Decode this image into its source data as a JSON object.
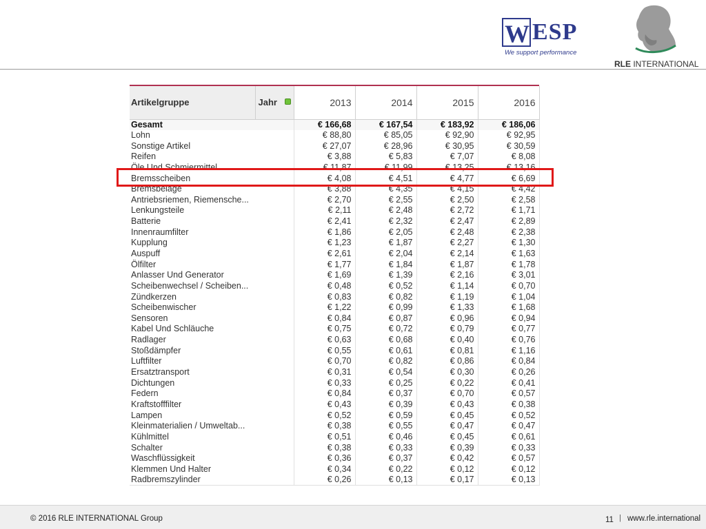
{
  "header": {
    "wesp_logo": {
      "first_letter": "W",
      "rest": "ESP",
      "tagline": "We support performance"
    },
    "rle_logo": {
      "name_bold": "RLE",
      "name_rest": " INTERNATIONAL"
    }
  },
  "table": {
    "headers": {
      "group": "Artikelgruppe",
      "jahr": "Jahr",
      "years": [
        "2013",
        "2014",
        "2015",
        "2016"
      ]
    },
    "total": {
      "label": "Gesamt",
      "values": [
        "€ 166,68",
        "€ 167,54",
        "€ 183,92",
        "€ 186,06"
      ]
    },
    "rows": [
      {
        "label": "Lohn",
        "values": [
          "€ 88,80",
          "€ 85,05",
          "€ 92,90",
          "€ 92,95"
        ]
      },
      {
        "label": "Sonstige Artikel",
        "values": [
          "€ 27,07",
          "€ 28,96",
          "€ 30,95",
          "€ 30,59"
        ]
      },
      {
        "label": "Reifen",
        "values": [
          "€ 3,88",
          "€ 5,83",
          "€ 7,07",
          "€ 8,08"
        ]
      },
      {
        "label": "Öle Und Schmiermittel",
        "values": [
          "€ 11,87",
          "€ 11,99",
          "€ 13,25",
          "€ 13,16"
        ]
      },
      {
        "label": "Bremsscheiben",
        "values": [
          "€ 4,08",
          "€ 4,51",
          "€ 4,77",
          "€ 6,69"
        ]
      },
      {
        "label": "Bremsbeläge",
        "values": [
          "€ 3,88",
          "€ 4,35",
          "€ 4,15",
          "€ 4,42"
        ]
      },
      {
        "label": "Antriebsriemen, Riemensche...",
        "values": [
          "€ 2,70",
          "€ 2,55",
          "€ 2,50",
          "€ 2,58"
        ]
      },
      {
        "label": "Lenkungsteile",
        "values": [
          "€ 2,11",
          "€ 2,48",
          "€ 2,72",
          "€ 1,71"
        ]
      },
      {
        "label": "Batterie",
        "values": [
          "€ 2,41",
          "€ 2,32",
          "€ 2,47",
          "€ 2,89"
        ]
      },
      {
        "label": "Innenraumfilter",
        "values": [
          "€ 1,86",
          "€ 2,05",
          "€ 2,48",
          "€ 2,38"
        ]
      },
      {
        "label": "Kupplung",
        "values": [
          "€ 1,23",
          "€ 1,87",
          "€ 2,27",
          "€ 1,30"
        ]
      },
      {
        "label": "Auspuff",
        "values": [
          "€ 2,61",
          "€ 2,04",
          "€ 2,14",
          "€ 1,63"
        ]
      },
      {
        "label": "Ölfilter",
        "values": [
          "€ 1,77",
          "€ 1,84",
          "€ 1,87",
          "€ 1,78"
        ]
      },
      {
        "label": "Anlasser Und Generator",
        "values": [
          "€ 1,69",
          "€ 1,39",
          "€ 2,16",
          "€ 3,01"
        ]
      },
      {
        "label": "Scheibenwechsel / Scheiben...",
        "values": [
          "€ 0,48",
          "€ 0,52",
          "€ 1,14",
          "€ 0,70"
        ]
      },
      {
        "label": "Zündkerzen",
        "values": [
          "€ 0,83",
          "€ 0,82",
          "€ 1,19",
          "€ 1,04"
        ]
      },
      {
        "label": "Scheibenwischer",
        "values": [
          "€ 1,22",
          "€ 0,99",
          "€ 1,33",
          "€ 1,68"
        ]
      },
      {
        "label": "Sensoren",
        "values": [
          "€ 0,84",
          "€ 0,87",
          "€ 0,96",
          "€ 0,94"
        ]
      },
      {
        "label": "Kabel Und Schläuche",
        "values": [
          "€ 0,75",
          "€ 0,72",
          "€ 0,79",
          "€ 0,77"
        ]
      },
      {
        "label": "Radlager",
        "values": [
          "€ 0,63",
          "€ 0,68",
          "€ 0,40",
          "€ 0,76"
        ]
      },
      {
        "label": "Stoßdämpfer",
        "values": [
          "€ 0,55",
          "€ 0,61",
          "€ 0,81",
          "€ 1,16"
        ]
      },
      {
        "label": "Luftfilter",
        "values": [
          "€ 0,70",
          "€ 0,82",
          "€ 0,86",
          "€ 0,84"
        ]
      },
      {
        "label": "Ersatztransport",
        "values": [
          "€ 0,31",
          "€ 0,54",
          "€ 0,30",
          "€ 0,26"
        ]
      },
      {
        "label": "Dichtungen",
        "values": [
          "€ 0,33",
          "€ 0,25",
          "€ 0,22",
          "€ 0,41"
        ]
      },
      {
        "label": "Federn",
        "values": [
          "€ 0,84",
          "€ 0,37",
          "€ 0,70",
          "€ 0,57"
        ]
      },
      {
        "label": "Kraftstofffilter",
        "values": [
          "€ 0,43",
          "€ 0,39",
          "€ 0,43",
          "€ 0,38"
        ]
      },
      {
        "label": "Lampen",
        "values": [
          "€ 0,52",
          "€ 0,59",
          "€ 0,45",
          "€ 0,52"
        ]
      },
      {
        "label": "Kleinmaterialien / Umweltab...",
        "values": [
          "€ 0,38",
          "€ 0,55",
          "€ 0,47",
          "€ 0,47"
        ]
      },
      {
        "label": "Kühlmittel",
        "values": [
          "€ 0,51",
          "€ 0,46",
          "€ 0,45",
          "€ 0,61"
        ]
      },
      {
        "label": "Schalter",
        "values": [
          "€ 0,38",
          "€ 0,33",
          "€ 0,39",
          "€ 0,33"
        ]
      },
      {
        "label": "Waschflüssigkeit",
        "values": [
          "€ 0,36",
          "€ 0,37",
          "€ 0,42",
          "€ 0,57"
        ]
      },
      {
        "label": "Klemmen Und Halter",
        "values": [
          "€ 0,34",
          "€ 0,22",
          "€ 0,12",
          "€ 0,12"
        ]
      },
      {
        "label": "Radbremszylinder",
        "values": [
          "€ 0,26",
          "€ 0,13",
          "€ 0,17",
          "€ 0,13"
        ]
      }
    ],
    "highlighted_row": "Bremsscheiben",
    "colors": {
      "highlight": "#e01919",
      "top_rule": "#b03050",
      "jahr_indicator": "#6fc33a"
    }
  },
  "footer": {
    "copyright": "© 2016 RLE INTERNATIONAL Group",
    "page_number": "11",
    "separator": "|",
    "url": "www.rle.international"
  }
}
